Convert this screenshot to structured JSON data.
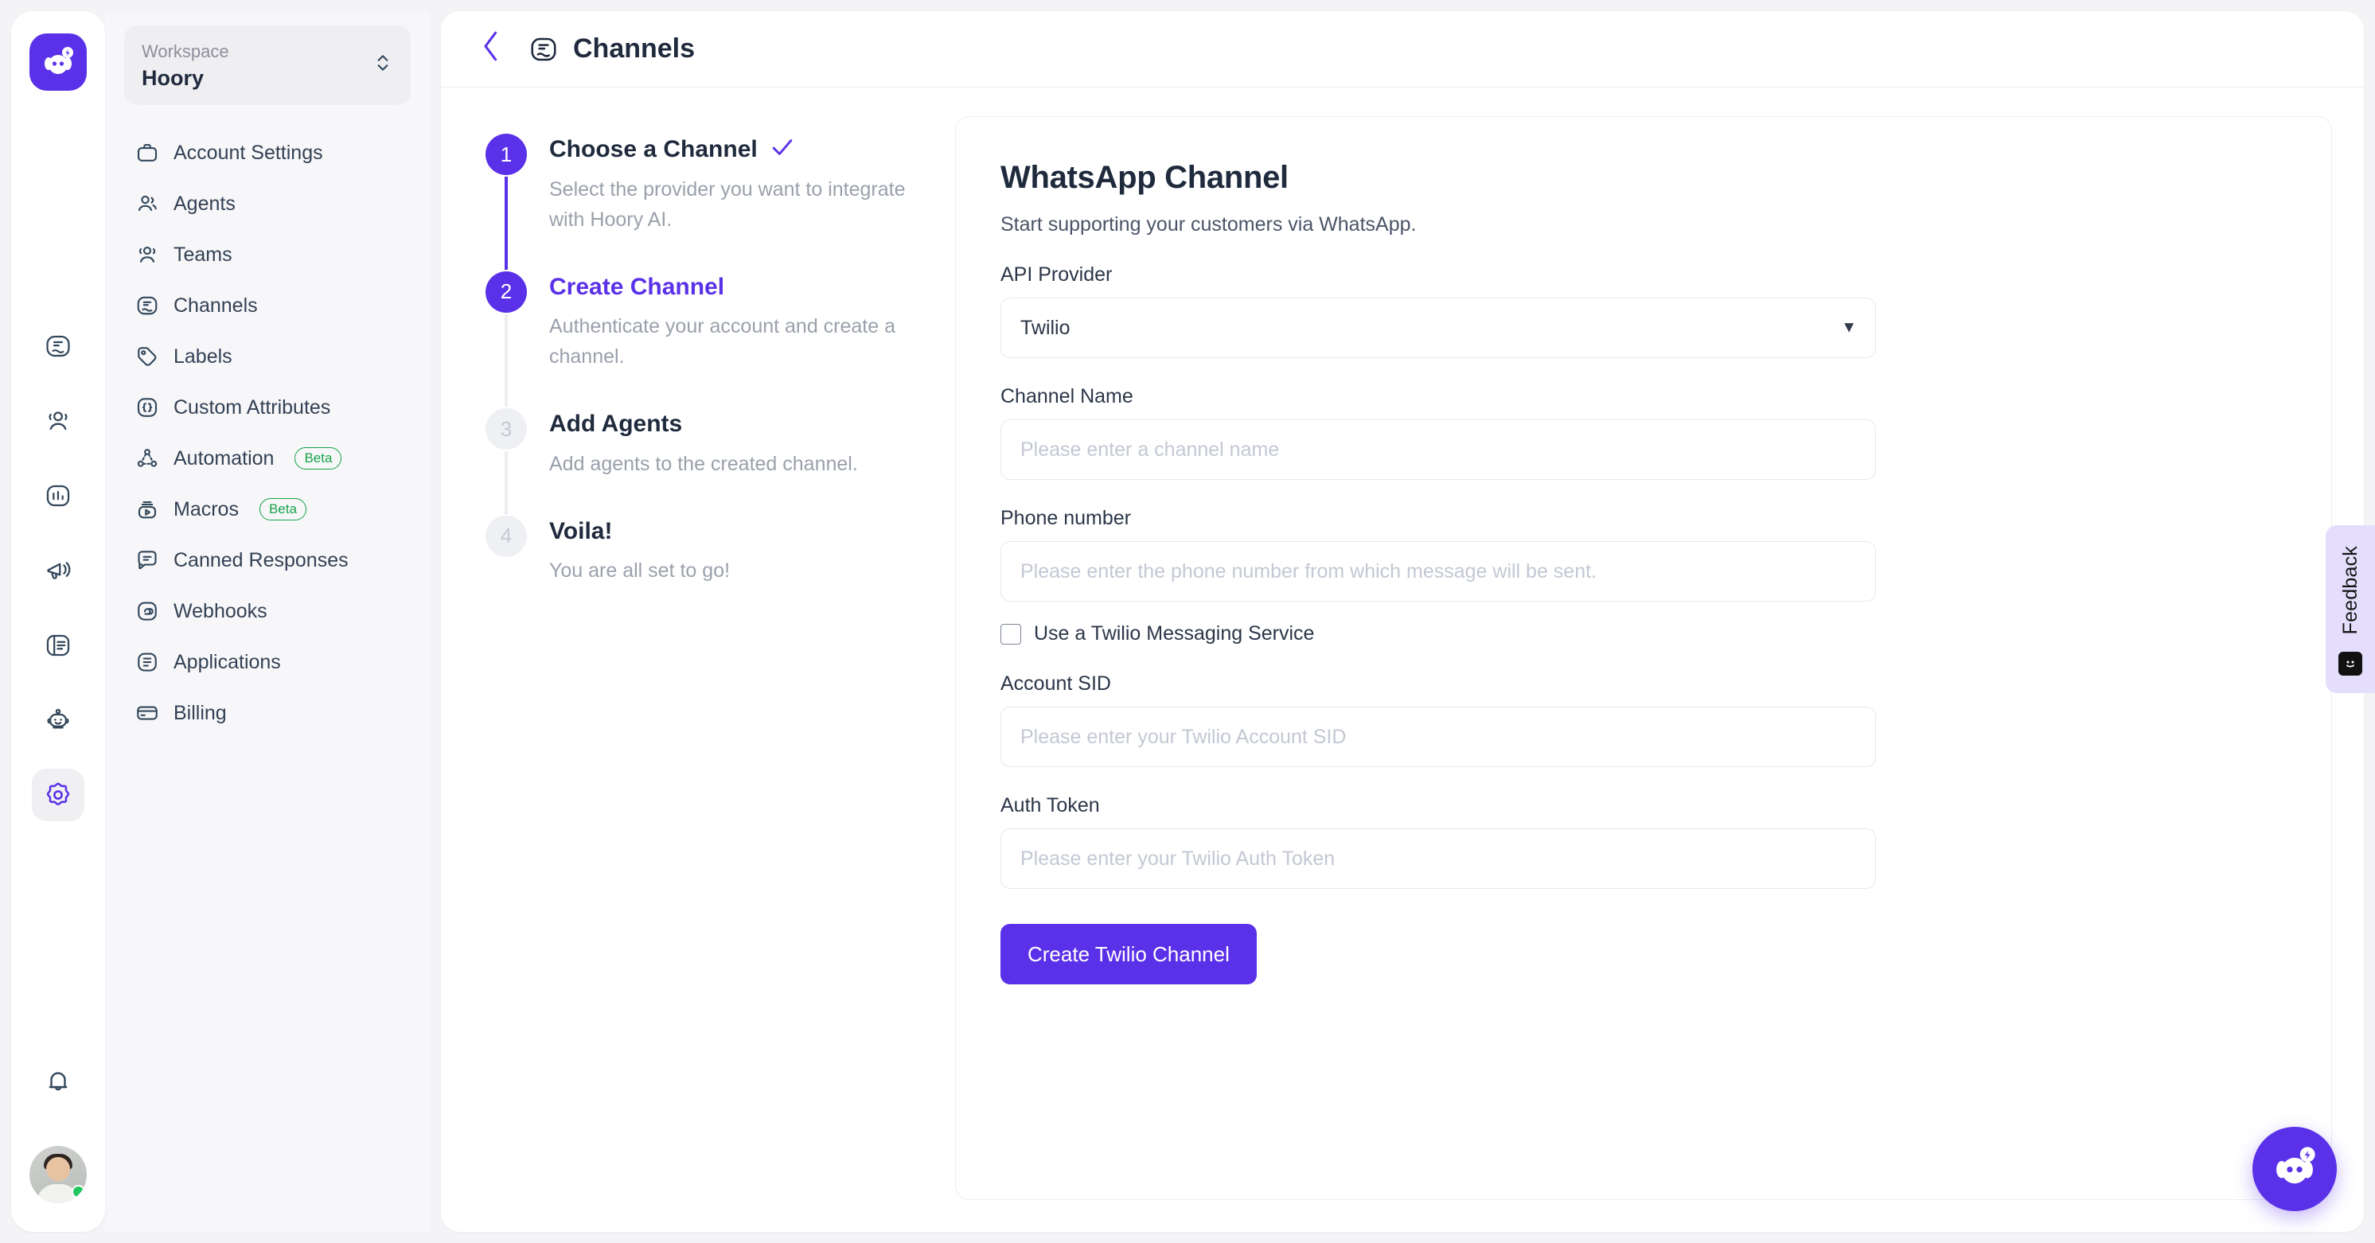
{
  "rail": {
    "logo_icon": "hoory-logo-icon",
    "items": [
      {
        "icon": "conversations-icon",
        "name": "conversations",
        "active": false
      },
      {
        "icon": "contacts-icon",
        "name": "contacts",
        "active": false
      },
      {
        "icon": "reports-icon",
        "name": "reports",
        "active": false
      },
      {
        "icon": "campaigns-icon",
        "name": "campaigns",
        "active": false
      },
      {
        "icon": "knowledge-base-icon",
        "name": "knowledge-base",
        "active": false
      },
      {
        "icon": "bot-icon",
        "name": "bot",
        "active": false
      },
      {
        "icon": "gear-icon",
        "name": "settings",
        "active": true
      }
    ],
    "notifications_icon": "bell-icon",
    "avatar_name": "user-avatar"
  },
  "sidebar": {
    "workspace_label": "Workspace",
    "workspace_name": "Hoory",
    "switcher_icon": "chevron-updown-icon",
    "items": [
      {
        "label": "Account Settings",
        "icon": "briefcase-icon",
        "badge": null
      },
      {
        "label": "Agents",
        "icon": "agent-icon",
        "badge": null
      },
      {
        "label": "Teams",
        "icon": "teams-icon",
        "badge": null
      },
      {
        "label": "Channels",
        "icon": "channels-icon",
        "badge": null
      },
      {
        "label": "Labels",
        "icon": "label-icon",
        "badge": null
      },
      {
        "label": "Custom Attributes",
        "icon": "braces-icon",
        "badge": null
      },
      {
        "label": "Automation",
        "icon": "automation-icon",
        "badge": "Beta"
      },
      {
        "label": "Macros",
        "icon": "macros-icon",
        "badge": "Beta"
      },
      {
        "label": "Canned Responses",
        "icon": "canned-icon",
        "badge": null
      },
      {
        "label": "Webhooks",
        "icon": "webhook-icon",
        "badge": null
      },
      {
        "label": "Applications",
        "icon": "applications-icon",
        "badge": null
      },
      {
        "label": "Billing",
        "icon": "billing-icon",
        "badge": null
      }
    ]
  },
  "topbar": {
    "back_icon": "chevron-left-icon",
    "title_icon": "channels-icon",
    "title": "Channels"
  },
  "stepper": {
    "steps": [
      {
        "number": "1",
        "title": "Choose a Channel",
        "description": "Select the provider you want to integrate with Hoory AI.",
        "state": "done",
        "check_icon": "check-icon"
      },
      {
        "number": "2",
        "title": "Create Channel",
        "description": "Authenticate your account and create a channel.",
        "state": "current"
      },
      {
        "number": "3",
        "title": "Add Agents",
        "description": "Add agents to the created channel.",
        "state": "todo"
      },
      {
        "number": "4",
        "title": "Voila!",
        "description": "You are all set to go!",
        "state": "todo"
      }
    ]
  },
  "form": {
    "title": "WhatsApp Channel",
    "subtitle": "Start supporting your customers via WhatsApp.",
    "api_provider_label": "API Provider",
    "api_provider_value": "Twilio",
    "api_provider_options": [
      "Twilio"
    ],
    "caret_icon": "chevron-down-icon",
    "channel_name_label": "Channel Name",
    "channel_name_value": "",
    "channel_name_placeholder": "Please enter a channel name",
    "phone_label": "Phone number",
    "phone_value": "",
    "phone_placeholder": "Please enter the phone number from which message will be sent.",
    "messaging_service_checkbox_label": "Use a Twilio Messaging Service",
    "messaging_service_checked": false,
    "account_sid_label": "Account SID",
    "account_sid_value": "",
    "account_sid_placeholder": "Please enter your Twilio Account SID",
    "auth_token_label": "Auth Token",
    "auth_token_value": "",
    "auth_token_placeholder": "Please enter your Twilio Auth Token",
    "submit_label": "Create Twilio Channel"
  },
  "feedback": {
    "label": "Feedback",
    "icon": "smiley-icon"
  },
  "fab": {
    "icon": "hoory-assistant-icon"
  },
  "colors": {
    "accent": "#5a31e8",
    "text_dark": "#1f2a3d",
    "text_muted": "#9aa0ab",
    "badge_green": "#16a34a",
    "page_bg": "#f4f4f6",
    "sidebar_bg": "#f7f7f9",
    "feedback_bg": "#e4ddfb"
  }
}
